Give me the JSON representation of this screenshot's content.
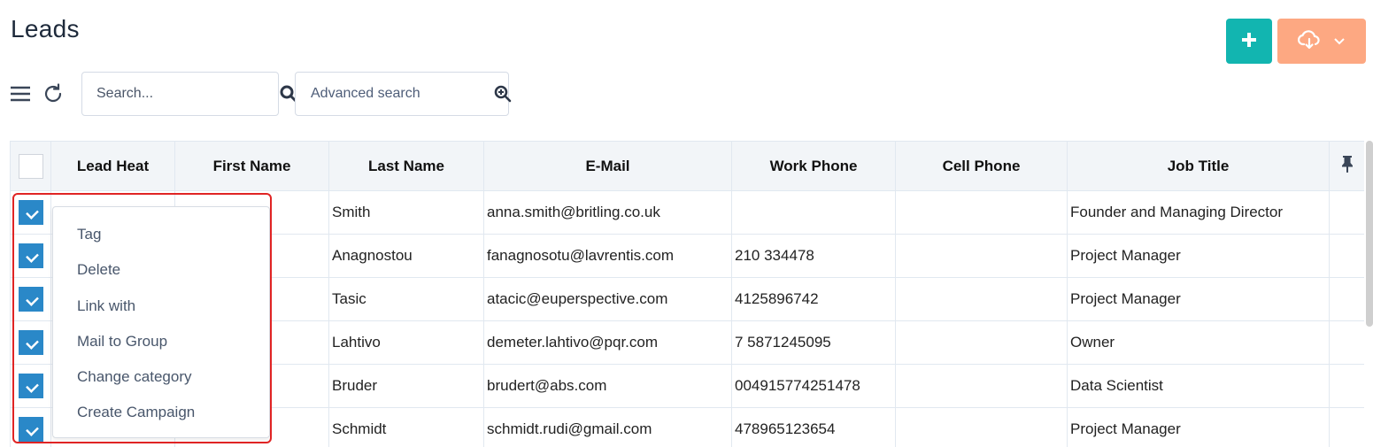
{
  "page": {
    "title": "Leads"
  },
  "header_actions": {
    "add_icon": "plus-icon",
    "export_icon": "cloud-download-icon",
    "export_dropdown_icon": "chevron-down-icon",
    "add_color": "#12b5b0",
    "export_color": "#fda882"
  },
  "toolbar": {
    "menu_icon": "hamburger-icon",
    "refresh_icon": "refresh-icon",
    "search": {
      "placeholder": "Search...",
      "value": "",
      "icon": "search-icon"
    },
    "advanced_search": {
      "placeholder": "Advanced search",
      "value": "",
      "icon": "zoom-in-icon"
    }
  },
  "table": {
    "columns": [
      "",
      "Lead Heat",
      "First Name",
      "Last Name",
      "E-Mail",
      "Work Phone",
      "Cell Phone",
      "Job Title",
      ""
    ],
    "pin_icon": "pin-icon",
    "rows": [
      {
        "checked": true,
        "lead_heat": "",
        "first_name": "",
        "last_name": "Smith",
        "email": "anna.smith@britling.co.uk",
        "work_phone": "",
        "cell_phone": "",
        "job_title": "Founder and Managing Director"
      },
      {
        "checked": true,
        "lead_heat": "",
        "first_name": "",
        "last_name": "Anagnostou",
        "email": "fanagnosotu@lavrentis.com",
        "work_phone": "210 334478",
        "cell_phone": "",
        "job_title": "Project Manager"
      },
      {
        "checked": true,
        "lead_heat": "",
        "first_name": "",
        "last_name": "Tasic",
        "email": "atacic@euperspective.com",
        "work_phone": "4125896742",
        "cell_phone": "",
        "job_title": "Project Manager"
      },
      {
        "checked": true,
        "lead_heat": "",
        "first_name": "",
        "last_name": "Lahtivo",
        "email": "demeter.lahtivo@pqr.com",
        "work_phone": "7 5871245095",
        "cell_phone": "",
        "job_title": "Owner"
      },
      {
        "checked": true,
        "lead_heat": "",
        "first_name": "",
        "last_name": "Bruder",
        "email": "brudert@abs.com",
        "work_phone": "004915774251478",
        "cell_phone": "",
        "job_title": "Data Scientist"
      },
      {
        "checked": true,
        "lead_heat": "",
        "first_name": "",
        "last_name": "Schmidt",
        "email": "schmidt.rudi@gmail.com",
        "work_phone": "478965123654",
        "cell_phone": "",
        "job_title": "Project Manager"
      }
    ]
  },
  "context_menu": {
    "items": [
      "Tag",
      "Delete",
      "Link with",
      "Mail to Group",
      "Change category",
      "Create Campaign"
    ]
  },
  "colors": {
    "checkbox_checked": "#2a88c8",
    "highlight_border": "#e02424",
    "header_bg": "#f2f5f8"
  }
}
